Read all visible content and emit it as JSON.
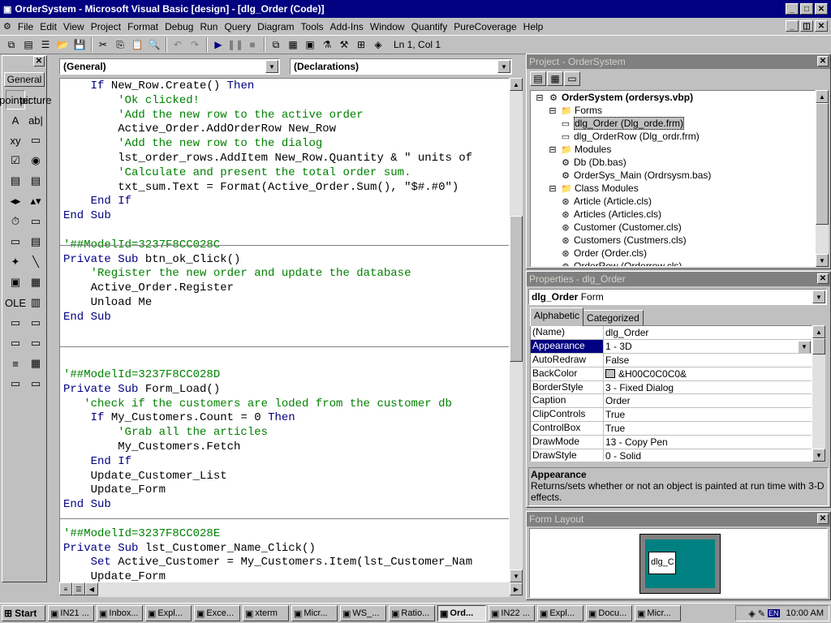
{
  "window": {
    "title": "OrderSystem - Microsoft Visual Basic [design] - [dlg_Order (Code)]",
    "minimize_icon": "minimize-icon",
    "maximize_icon": "maximize-icon",
    "close_icon": "close-icon"
  },
  "menu": [
    "File",
    "Edit",
    "View",
    "Project",
    "Format",
    "Debug",
    "Run",
    "Query",
    "Diagram",
    "Tools",
    "Add-Ins",
    "Window",
    "Quantify",
    "PureCoverage",
    "Help"
  ],
  "toolbar": {
    "status": "Ln 1, Col 1"
  },
  "toolbox": {
    "tab_label": "General",
    "tools": [
      "pointer",
      "picture",
      "A",
      "ab|",
      "xy",
      "▭",
      "☑",
      "◉",
      "▤",
      "▤",
      "◂▸",
      "▴▾",
      "⏱",
      "▭",
      "▭",
      "▤",
      "✦",
      "╲",
      "▣",
      "▦",
      "OLE",
      "▥",
      "▭",
      "▭",
      "▭",
      "▭",
      "≡",
      "▦",
      "▭",
      "▭"
    ]
  },
  "code": {
    "object_combo": "(General)",
    "proc_combo": "(Declarations)",
    "lines": [
      [
        {
          "t": "    ",
          "c": ""
        },
        {
          "t": "If",
          "c": "kw"
        },
        {
          "t": " New_Row.Create() ",
          "c": ""
        },
        {
          "t": "Then",
          "c": "kw"
        }
      ],
      [
        {
          "t": "        'Ok clicked!",
          "c": "cm"
        }
      ],
      [
        {
          "t": "        'Add the new row to the active order",
          "c": "cm"
        }
      ],
      [
        {
          "t": "        Active_Order.AddOrderRow New_Row",
          "c": ""
        }
      ],
      [
        {
          "t": "        'Add the new row to the dialog",
          "c": "cm"
        }
      ],
      [
        {
          "t": "        lst_order_rows.AddItem New_Row.Quantity & \" units of",
          "c": ""
        }
      ],
      [
        {
          "t": "        'Calculate and present the total order sum.",
          "c": "cm"
        }
      ],
      [
        {
          "t": "        txt_sum.Text = Format(Active_Order.Sum(), \"$#.#0\")",
          "c": ""
        }
      ],
      [
        {
          "t": "    ",
          "c": ""
        },
        {
          "t": "End If",
          "c": "kw"
        }
      ],
      [
        {
          "t": "End Sub",
          "c": "kw"
        }
      ],
      [
        {
          "t": "",
          "c": ""
        }
      ],
      [
        {
          "t": "'##ModelId=3237F8CC028C",
          "c": "cm"
        }
      ],
      [
        {
          "t": "Private Sub",
          "c": "kw"
        },
        {
          "t": " btn_ok_Click()",
          "c": ""
        }
      ],
      [
        {
          "t": "    'Register the new order and update the database",
          "c": "cm"
        }
      ],
      [
        {
          "t": "    Active_Order.Register",
          "c": ""
        }
      ],
      [
        {
          "t": "    Unload Me",
          "c": ""
        }
      ],
      [
        {
          "t": "End Sub",
          "c": "kw"
        }
      ],
      [
        {
          "t": "",
          "c": ""
        }
      ],
      [
        {
          "t": "",
          "c": ""
        }
      ],
      [
        {
          "t": "",
          "c": ""
        }
      ],
      [
        {
          "t": "'##ModelId=3237F8CC028D",
          "c": "cm"
        }
      ],
      [
        {
          "t": "Private Sub",
          "c": "kw"
        },
        {
          "t": " Form_Load()",
          "c": ""
        }
      ],
      [
        {
          "t": "   'check if the customers are loded from the customer db",
          "c": "cm"
        }
      ],
      [
        {
          "t": "    ",
          "c": ""
        },
        {
          "t": "If",
          "c": "kw"
        },
        {
          "t": " My_Customers.Count = 0 ",
          "c": ""
        },
        {
          "t": "Then",
          "c": "kw"
        }
      ],
      [
        {
          "t": "        'Grab all the articles",
          "c": "cm"
        }
      ],
      [
        {
          "t": "        My_Customers.Fetch",
          "c": ""
        }
      ],
      [
        {
          "t": "    ",
          "c": ""
        },
        {
          "t": "End If",
          "c": "kw"
        }
      ],
      [
        {
          "t": "    Update_Customer_List",
          "c": ""
        }
      ],
      [
        {
          "t": "    Update_Form",
          "c": ""
        }
      ],
      [
        {
          "t": "End Sub",
          "c": "kw"
        }
      ],
      [
        {
          "t": "",
          "c": ""
        }
      ],
      [
        {
          "t": "'##ModelId=3237F8CC028E",
          "c": "cm"
        }
      ],
      [
        {
          "t": "Private Sub",
          "c": "kw"
        },
        {
          "t": " lst_Customer_Name_Click()",
          "c": ""
        }
      ],
      [
        {
          "t": "    ",
          "c": ""
        },
        {
          "t": "Set",
          "c": "kw"
        },
        {
          "t": " Active_Customer = My_Customers.Item(lst_Customer_Nam",
          "c": ""
        }
      ],
      [
        {
          "t": "    Update_Form",
          "c": ""
        }
      ]
    ]
  },
  "project": {
    "title": "Project - OrderSystem",
    "tree": [
      {
        "label": "OrderSystem (ordersys.vbp)",
        "level": 0,
        "icon": "project-icon",
        "bold": true,
        "exp": "⊟"
      },
      {
        "label": "Forms",
        "level": 1,
        "icon": "folder-icon",
        "exp": "⊟"
      },
      {
        "label": "dlg_Order (Dlg_orde.frm)",
        "level": 2,
        "icon": "form-icon",
        "selected": true
      },
      {
        "label": "dlg_OrderRow (Dlg_ordr.frm)",
        "level": 2,
        "icon": "form-icon"
      },
      {
        "label": "Modules",
        "level": 1,
        "icon": "folder-icon",
        "exp": "⊟"
      },
      {
        "label": "Db (Db.bas)",
        "level": 2,
        "icon": "module-icon"
      },
      {
        "label": "OrderSys_Main (Ordrsysm.bas)",
        "level": 2,
        "icon": "module-icon"
      },
      {
        "label": "Class Modules",
        "level": 1,
        "icon": "folder-icon",
        "exp": "⊟"
      },
      {
        "label": "Article (Article.cls)",
        "level": 2,
        "icon": "class-icon"
      },
      {
        "label": "Articles (Articles.cls)",
        "level": 2,
        "icon": "class-icon"
      },
      {
        "label": "Customer (Customer.cls)",
        "level": 2,
        "icon": "class-icon"
      },
      {
        "label": "Customers (Custmers.cls)",
        "level": 2,
        "icon": "class-icon"
      },
      {
        "label": "Order (Order.cls)",
        "level": 2,
        "icon": "class-icon"
      },
      {
        "label": "OrderRow (Orderrow.cls)",
        "level": 2,
        "icon": "class-icon"
      }
    ]
  },
  "properties": {
    "title": "Properties - dlg_Order",
    "object_name": "dlg_Order",
    "object_type": "Form",
    "tab_alpha": "Alphabetic",
    "tab_cat": "Categorized",
    "rows": [
      {
        "name": "(Name)",
        "value": "dlg_Order"
      },
      {
        "name": "Appearance",
        "value": "1 - 3D",
        "selected": true
      },
      {
        "name": "AutoRedraw",
        "value": "False"
      },
      {
        "name": "BackColor",
        "value": "&H00C0C0C0&",
        "swatch": "#c0c0c0"
      },
      {
        "name": "BorderStyle",
        "value": "3 - Fixed Dialog"
      },
      {
        "name": "Caption",
        "value": "Order"
      },
      {
        "name": "ClipControls",
        "value": "True"
      },
      {
        "name": "ControlBox",
        "value": "True"
      },
      {
        "name": "DrawMode",
        "value": "13 - Copy Pen"
      },
      {
        "name": "DrawStyle",
        "value": "0 - Solid"
      }
    ],
    "desc_title": "Appearance",
    "desc_text": "Returns/sets whether or not an object is painted at run time with 3-D effects."
  },
  "layout": {
    "title": "Form Layout",
    "form_label": "dlg_C"
  },
  "taskbar": {
    "start": "Start",
    "items": [
      {
        "label": "IN21 ..."
      },
      {
        "label": "Inbox..."
      },
      {
        "label": "Expl..."
      },
      {
        "label": "Exce..."
      },
      {
        "label": "xterm"
      },
      {
        "label": "Micr..."
      },
      {
        "label": "WS_..."
      },
      {
        "label": "Ratio..."
      },
      {
        "label": "Ord...",
        "pressed": true
      },
      {
        "label": "IN22 ..."
      },
      {
        "label": "Expl..."
      },
      {
        "label": "Docu..."
      },
      {
        "label": "Micr..."
      }
    ],
    "clock": "10:00 AM"
  }
}
